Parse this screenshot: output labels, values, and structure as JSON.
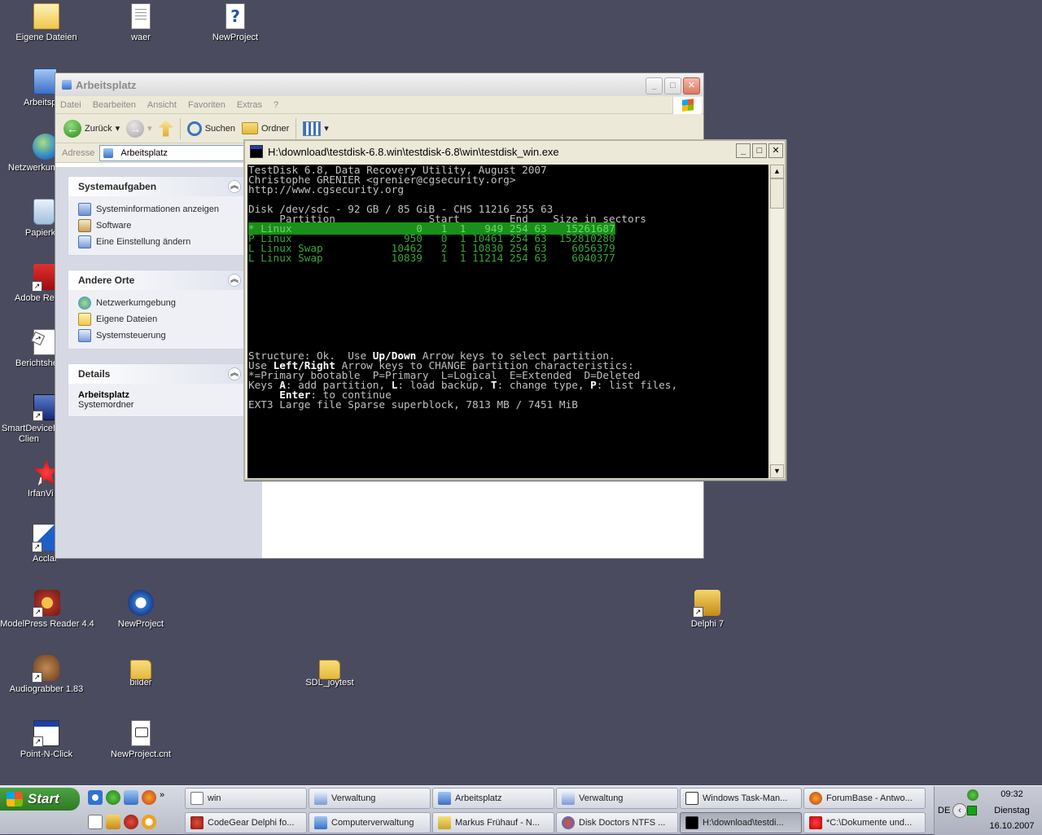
{
  "desktop": {
    "icons": [
      {
        "label": "Eigene Dateien",
        "icon": "my-documents-icon"
      },
      {
        "label": "waer",
        "icon": "document-icon"
      },
      {
        "label": "NewProject",
        "icon": "help-file-icon"
      },
      {
        "label": "Arbeitsp",
        "icon": "my-computer-icon"
      },
      {
        "label": "Netzwerkum",
        "icon": "network-icon"
      },
      {
        "label": "Papierk",
        "icon": "recycle-bin-icon"
      },
      {
        "label": "Adobe Re",
        "icon": "pdf-icon"
      },
      {
        "label": "Berichtshe",
        "icon": "report-icon"
      },
      {
        "label": "SmartDeviceM\nClien",
        "icon": "app-icon"
      },
      {
        "label": "IrfanVi",
        "icon": "irfanview-icon"
      },
      {
        "label": "Acclaro",
        "icon": "sail-icon"
      },
      {
        "label": "ModelPress Reader 4.4",
        "icon": "modelpress-icon"
      },
      {
        "label": "NewProject",
        "icon": "ie-project-icon"
      },
      {
        "label": "Delphi 7",
        "icon": "delphi-icon"
      },
      {
        "label": "Audiograbber 1.83",
        "icon": "audiograbber-icon"
      },
      {
        "label": "bilder",
        "icon": "folder-icon"
      },
      {
        "label": "SDL_joytest",
        "icon": "folder-icon"
      },
      {
        "label": "Point-N-Click",
        "icon": "window-app-icon"
      },
      {
        "label": "NewProject.cnt",
        "icon": "cnt-file-icon"
      }
    ]
  },
  "explorer": {
    "title": "Arbeitsplatz",
    "menu": [
      "Datei",
      "Bearbeiten",
      "Ansicht",
      "Favoriten",
      "Extras",
      "?"
    ],
    "toolbar": {
      "back": "Zurück",
      "search": "Suchen",
      "folders": "Ordner"
    },
    "address_label": "Adresse",
    "address_value": "Arbeitsplatz",
    "panels": {
      "system_tasks": {
        "title": "Systemaufgaben",
        "items": [
          "Systeminformationen anzeigen",
          "Software",
          "Eine Einstellung ändern"
        ]
      },
      "other_places": {
        "title": "Andere Orte",
        "items": [
          "Netzwerkumgebung",
          "Eigene Dateien",
          "Systemsteuerung"
        ]
      },
      "details": {
        "title": "Details",
        "name": "Arbeitsplatz",
        "type": "Systemordner"
      }
    }
  },
  "console": {
    "title": "H:\\download\\testdisk-6.8.win\\testdisk-6.8\\win\\testdisk_win.exe",
    "header": [
      "TestDisk 6.8, Data Recovery Utility, August 2007",
      "Christophe GRENIER <grenier@cgsecurity.org>",
      "http://www.cgsecurity.org"
    ],
    "disk_line": "Disk /dev/sdc - 92 GB / 85 GiB - CHS 11216 255 63",
    "table_header": "     Partition               Start        End    Size in sectors",
    "partitions": [
      "* Linux                    0   1  1   949 254 63   15261687",
      "P Linux                  950   0  1 10461 254 63  152810280",
      "L Linux Swap           10462   2  1 10830 254 63    6056379",
      "L Linux Swap           10839   1  1 11214 254 63    6040377"
    ],
    "footer": {
      "l1a": "Structure: Ok.  Use ",
      "l1b": "Up/Down",
      "l1c": " Arrow keys to select partition.",
      "l2a": "Use ",
      "l2b": "Left/Right",
      "l2c": " Arrow keys to CHANGE partition characteristics:",
      "l3": "*=Primary bootable  P=Primary  L=Logical  E=Extended  D=Deleted",
      "l4a": "Keys ",
      "l4b": "A",
      "l4c": ": add partition, ",
      "l4d": "L",
      "l4e": ": load backup, ",
      "l4f": "T",
      "l4g": ": change type, ",
      "l4h": "P",
      "l4i": ": list files,",
      "l5a": "     ",
      "l5b": "Enter",
      "l5c": ": to continue",
      "l6": "EXT3 Large file Sparse superblock, 7813 MB / 7451 MiB"
    }
  },
  "taskbar": {
    "start": "Start",
    "row1": [
      {
        "label": "win",
        "icon": "folder-icon"
      },
      {
        "label": "Verwaltung",
        "icon": "admin-tools-icon"
      },
      {
        "label": "Arbeitsplatz",
        "icon": "my-computer-icon"
      },
      {
        "label": "Verwaltung",
        "icon": "admin-tools-icon"
      },
      {
        "label": "Windows Task-Man...",
        "icon": "task-manager-icon"
      },
      {
        "label": "ForumBase - Antwo...",
        "icon": "firefox-icon"
      }
    ],
    "row2": [
      {
        "label": "CodeGear Delphi fo...",
        "icon": "delphi-icon"
      },
      {
        "label": "Computerverwaltung",
        "icon": "computer-management-icon"
      },
      {
        "label": "Markus Frühauf - N...",
        "icon": "contact-icon"
      },
      {
        "label": "Disk Doctors NTFS ...",
        "icon": "disk-icon"
      },
      {
        "label": "H:\\download\\testdi...",
        "icon": "console-icon"
      },
      {
        "label": "*C:\\Dokumente und...",
        "icon": "irfanview-icon"
      }
    ],
    "tray": {
      "lang": "DE",
      "time": "09:32",
      "day": "Dienstag",
      "date": "16.10.2007"
    }
  }
}
